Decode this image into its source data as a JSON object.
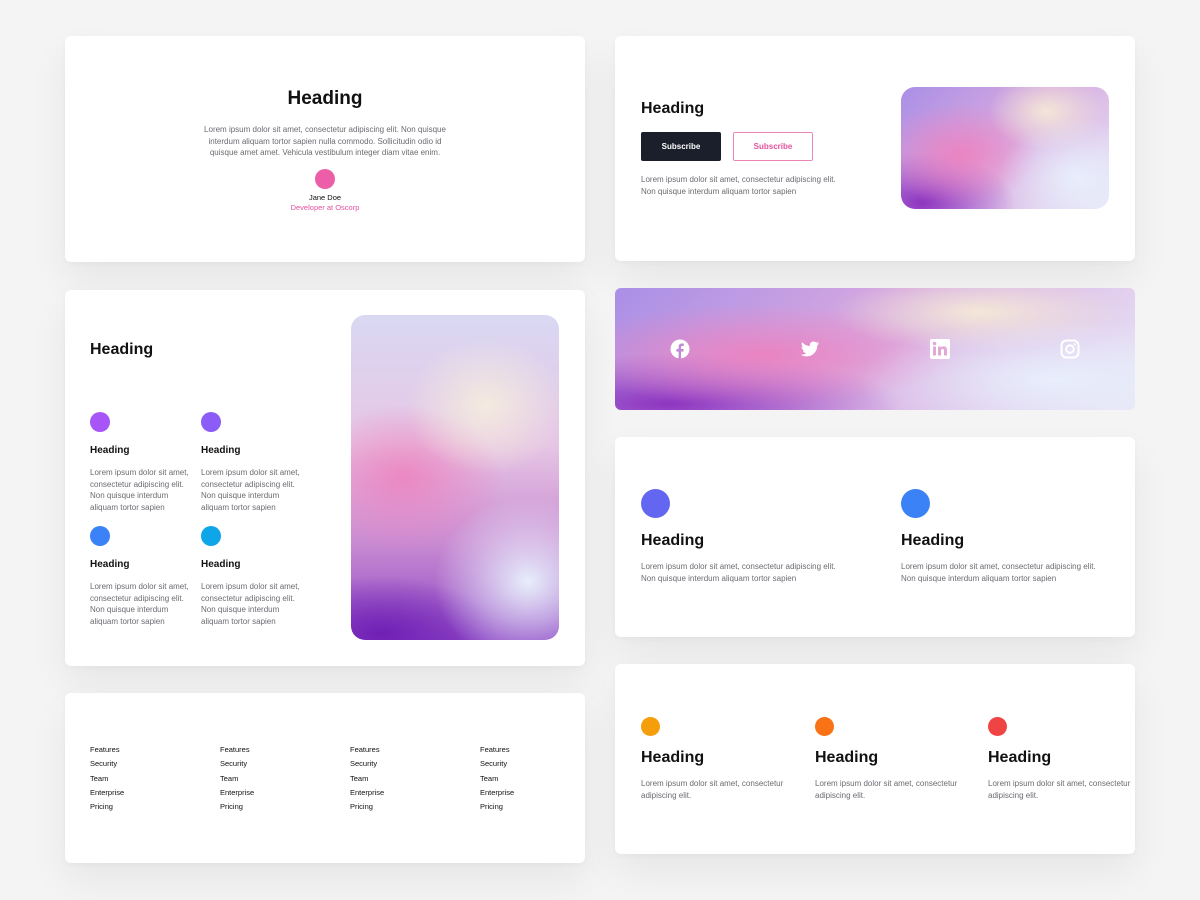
{
  "testimonial": {
    "heading": "Heading",
    "body": "Lorem ipsum dolor sit amet, consectetur adipiscing elit. Non quisque interdum aliquam tortor sapien nulla commodo. Sollicitudin odio id quisque amet amet. Vehicula vestibulum integer diam vitae enim.",
    "name": "Jane Doe",
    "role": "Developer at Oscorp",
    "avatar_color": "#ec5fa8"
  },
  "subscribe": {
    "heading": "Heading",
    "primary_button": "Subscribe",
    "secondary_button": "Subscribe",
    "body": "Lorem ipsum dolor sit amet, consectetur adipiscing elit. Non quisque interdum aliquam tortor sapien"
  },
  "feature_grid": {
    "heading": "Heading",
    "items": [
      {
        "heading": "Heading",
        "body": "Lorem ipsum dolor sit amet, consectetur adipiscing elit. Non quisque interdum aliquam tortor sapien",
        "color": "#a855f7"
      },
      {
        "heading": "Heading",
        "body": "Lorem ipsum dolor sit amet, consectetur adipiscing elit. Non quisque interdum aliquam tortor sapien",
        "color": "#8b5cf6"
      },
      {
        "heading": "Heading",
        "body": "Lorem ipsum dolor sit amet, consectetur adipiscing elit. Non quisque interdum aliquam tortor sapien",
        "color": "#3b82f6"
      },
      {
        "heading": "Heading",
        "body": "Lorem ipsum dolor sit amet, consectetur adipiscing elit. Non quisque interdum aliquam tortor sapien",
        "color": "#0ea5e9"
      }
    ]
  },
  "social": {
    "icons": [
      "facebook-icon",
      "twitter-icon",
      "linkedin-icon",
      "instagram-icon"
    ]
  },
  "two_features": {
    "items": [
      {
        "heading": "Heading",
        "body": "Lorem ipsum dolor sit amet, consectetur adipiscing elit. Non quisque interdum aliquam tortor sapien",
        "color": "#6366f1"
      },
      {
        "heading": "Heading",
        "body": "Lorem ipsum dolor sit amet, consectetur adipiscing elit. Non quisque interdum aliquam tortor sapien",
        "color": "#3b82f6"
      }
    ]
  },
  "footer_links": {
    "columns": [
      [
        "Features",
        "Security",
        "Team",
        "Enterprise",
        "Pricing"
      ],
      [
        "Features",
        "Security",
        "Team",
        "Enterprise",
        "Pricing"
      ],
      [
        "Features",
        "Security",
        "Team",
        "Enterprise",
        "Pricing"
      ],
      [
        "Features",
        "Security",
        "Team",
        "Enterprise",
        "Pricing"
      ]
    ]
  },
  "three_features": {
    "items": [
      {
        "heading": "Heading",
        "body": "Lorem ipsum dolor sit amet, consectetur adipiscing elit.",
        "color": "#f59e0b"
      },
      {
        "heading": "Heading",
        "body": "Lorem ipsum dolor sit amet, consectetur adipiscing elit.",
        "color": "#f97316"
      },
      {
        "heading": "Heading",
        "body": "Lorem ipsum dolor sit amet, consectetur adipiscing elit.",
        "color": "#ef4444"
      }
    ]
  },
  "colors": {
    "dark_button": "#1b1f2b",
    "accent_pink": "#e4529e",
    "page_background": "#f4f4f5"
  }
}
